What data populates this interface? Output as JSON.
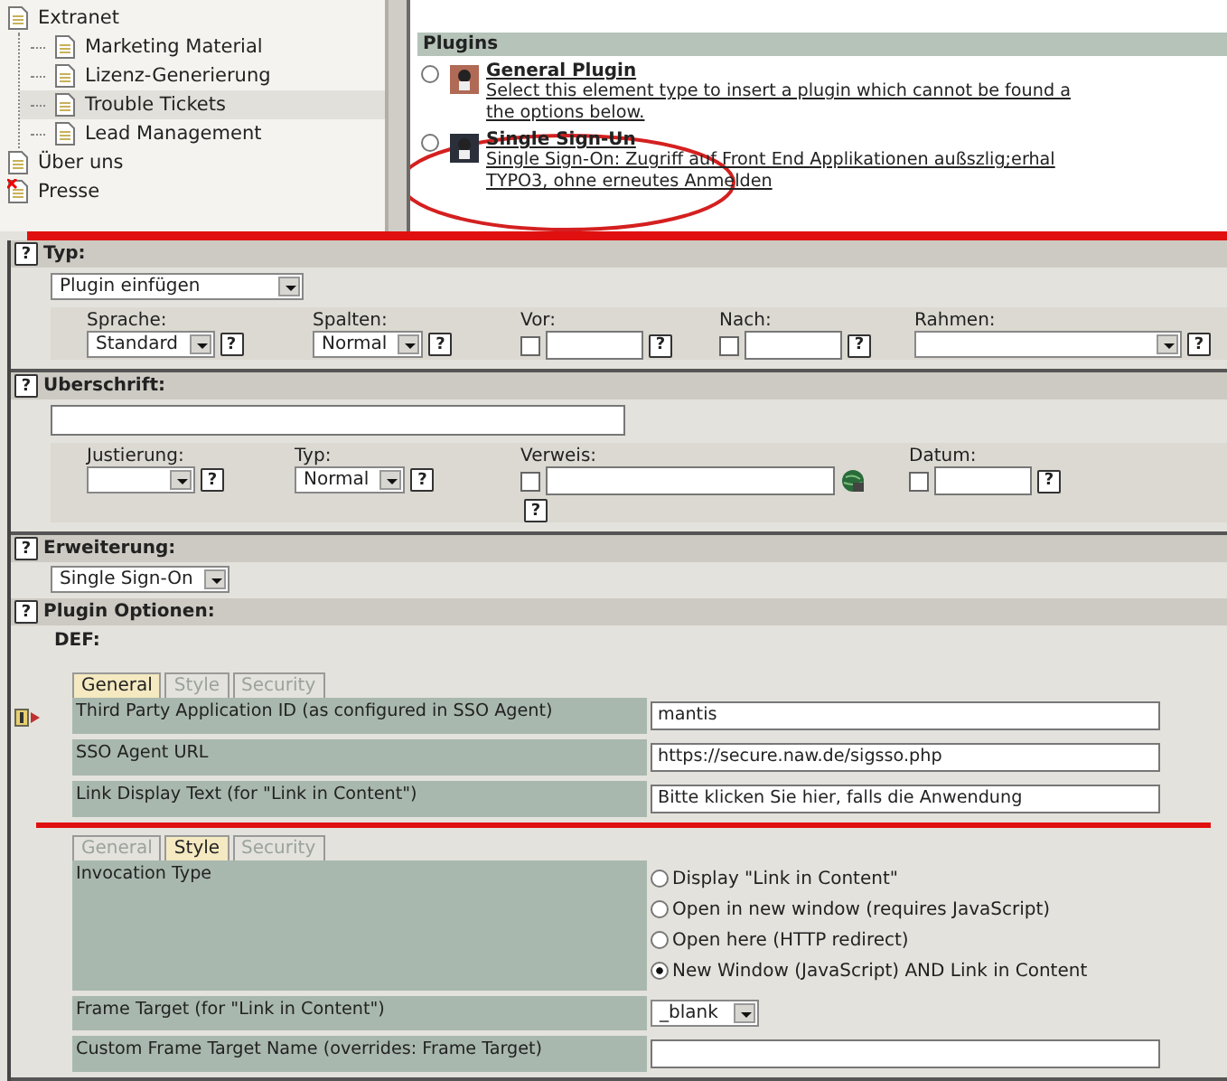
{
  "help_glyph": "?",
  "tree": [
    {
      "label": "Extranet",
      "selected": false,
      "deleted": false,
      "children": [
        {
          "label": "Marketing Material",
          "selected": false,
          "deleted": false
        },
        {
          "label": "Lizenz-Generierung",
          "selected": false,
          "deleted": false
        },
        {
          "label": "Trouble Tickets",
          "selected": true,
          "deleted": false
        },
        {
          "label": "Lead Management",
          "selected": false,
          "deleted": false
        }
      ]
    },
    {
      "label": "Über uns",
      "selected": false,
      "deleted": false
    },
    {
      "label": "Presse",
      "selected": false,
      "deleted": true
    }
  ],
  "plugins": {
    "title": "Plugins",
    "items": [
      {
        "name": "General Plugin",
        "selected": false,
        "description": [
          "Select this element type to insert a plugin which cannot be found a",
          "the options below."
        ]
      },
      {
        "name": "Single Sign-Un",
        "selected": false,
        "description": [
          "Single Sign-On: Zugriff auf Front End Applikationen außszlig;erhal",
          "TYPO3, ohne erneutes Anmelden"
        ]
      }
    ]
  },
  "typ": {
    "title": "Typ:",
    "value": "Plugin einfügen",
    "fields": [
      {
        "label": "Sprache:",
        "kind": "select",
        "value": "Standard"
      },
      {
        "label": "Spalten:",
        "kind": "select",
        "value": "Normal"
      },
      {
        "label": "Vor:",
        "kind": "check_input",
        "checked": false
      },
      {
        "label": "Nach:",
        "kind": "check_input",
        "checked": false
      },
      {
        "label": "Rahmen:",
        "kind": "wide_select"
      }
    ]
  },
  "heading": {
    "title": "Uberschrift:",
    "fields": [
      {
        "label": "Justierung:",
        "kind": "select"
      },
      {
        "label": "Typ:",
        "kind": "select",
        "value": "Normal"
      },
      {
        "label": "Verweis:",
        "kind": "link",
        "checked": false
      },
      {
        "label": "Datum:",
        "kind": "check_input",
        "checked": false
      }
    ]
  },
  "extension": {
    "title": "Erweiterung:",
    "value": "Single Sign-On"
  },
  "options": {
    "title": "Plugin Optionen:",
    "sheet": "DEF:",
    "groups": [
      {
        "tabs": [
          {
            "label": "General",
            "selected": true
          },
          {
            "label": "Style",
            "selected": false
          },
          {
            "label": "Security",
            "selected": false
          }
        ],
        "rows": [
          {
            "label": "Third Party Application ID (as configured in SSO Agent)",
            "kind": "text",
            "value": "mantis",
            "marked": true
          },
          {
            "label": "SSO Agent URL",
            "kind": "text",
            "value": "https://secure.naw.de/sigsso.php",
            "marked": false
          },
          {
            "label": "Link Display Text (for \"Link in Content\")",
            "kind": "text",
            "value": "Bitte klicken Sie hier, falls die Anwendung",
            "marked": false
          }
        ]
      },
      {
        "tabs": [
          {
            "label": "General",
            "selected": false
          },
          {
            "label": "Style",
            "selected": true
          },
          {
            "label": "Security",
            "selected": false
          }
        ],
        "rows": [
          {
            "label": "Invocation Type",
            "kind": "radio",
            "marked": false,
            "options": [
              {
                "label": "Display \"Link in Content\"",
                "selected": false
              },
              {
                "label": "Open in new window (requires JavaScript)",
                "selected": false
              },
              {
                "label": "Open here (HTTP redirect)",
                "selected": false
              },
              {
                "label": "New Window (JavaScript) AND Link in Content",
                "selected": true
              }
            ]
          },
          {
            "label": "Frame Target (for \"Link in Content\")",
            "kind": "select",
            "value": "_blank",
            "marked": false
          },
          {
            "label": "Custom Frame Target Name (overrides: Frame Target)",
            "kind": "text",
            "marked": false
          }
        ]
      }
    ]
  }
}
